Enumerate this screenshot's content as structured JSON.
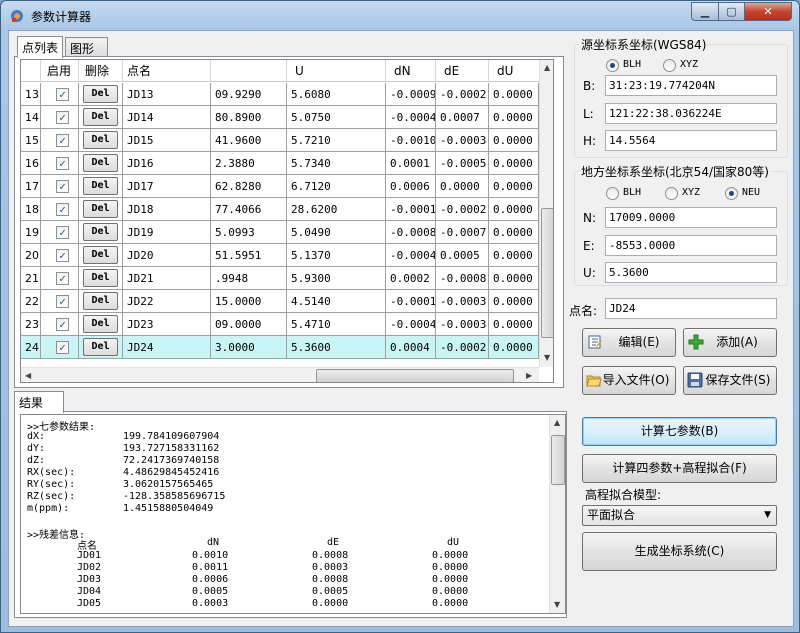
{
  "window": {
    "title": "参数计算器"
  },
  "tabs": {
    "points": "点列表",
    "graph": "图形",
    "results": "结果"
  },
  "grid": {
    "headers": {
      "enable": "启用",
      "delete": "删除",
      "name": "点名",
      "blank": "",
      "u": "U",
      "dn": "dN",
      "de": "dE",
      "du": "dU"
    },
    "del_label": "Del",
    "rows": [
      {
        "idx": "13",
        "name": "JD13",
        "h": "09.9290",
        "u": "5.6080",
        "dn": "-0.0009",
        "de": "-0.0002",
        "du": "0.0000"
      },
      {
        "idx": "14",
        "name": "JD14",
        "h": "80.8900",
        "u": "5.0750",
        "dn": "-0.0004",
        "de": "0.0007",
        "du": "0.0000"
      },
      {
        "idx": "15",
        "name": "JD15",
        "h": "41.9600",
        "u": "5.7210",
        "dn": "-0.0010",
        "de": "-0.0003",
        "du": "0.0000"
      },
      {
        "idx": "16",
        "name": "JD16",
        "h": "2.3880",
        "u": "5.7340",
        "dn": "0.0001",
        "de": "-0.0005",
        "du": "0.0000"
      },
      {
        "idx": "17",
        "name": "JD17",
        "h": "62.8280",
        "u": "6.7120",
        "dn": "0.0006",
        "de": "0.0000",
        "du": "0.0000"
      },
      {
        "idx": "18",
        "name": "JD18",
        "h": "77.4066",
        "u": "28.6200",
        "dn": "-0.0001",
        "de": "-0.0002",
        "du": "0.0000"
      },
      {
        "idx": "19",
        "name": "JD19",
        "h": "5.0993",
        "u": "5.0490",
        "dn": "-0.0008",
        "de": "-0.0007",
        "du": "0.0000"
      },
      {
        "idx": "20",
        "name": "JD20",
        "h": "51.5951",
        "u": "5.1370",
        "dn": "-0.0004",
        "de": "0.0005",
        "du": "0.0000"
      },
      {
        "idx": "21",
        "name": "JD21",
        "h": ".9948",
        "u": "5.9300",
        "dn": "0.0002",
        "de": "-0.0008",
        "du": "0.0000"
      },
      {
        "idx": "22",
        "name": "JD22",
        "h": "15.0000",
        "u": "4.5140",
        "dn": "-0.0001",
        "de": "-0.0003",
        "du": "0.0000"
      },
      {
        "idx": "23",
        "name": "JD23",
        "h": "09.0000",
        "u": "5.4710",
        "dn": "-0.0004",
        "de": "-0.0003",
        "du": "0.0000"
      },
      {
        "idx": "24",
        "name": "JD24",
        "h": "3.0000",
        "u": "5.3600",
        "dn": "0.0004",
        "de": "-0.0002",
        "du": "0.0000"
      }
    ]
  },
  "results": {
    "seven_title": ">>七参数结果:",
    "params": [
      {
        "k": "dX:",
        "v": "199.784109607904"
      },
      {
        "k": "dY:",
        "v": "193.727158331162"
      },
      {
        "k": "dZ:",
        "v": "72.2417369740158"
      },
      {
        "k": "RX(sec):",
        "v": "4.48629845452416"
      },
      {
        "k": "RY(sec):",
        "v": "3.0620157565465"
      },
      {
        "k": "RZ(sec):",
        "v": "-128.358585696715"
      },
      {
        "k": "m(ppm):",
        "v": "1.4515880504049"
      }
    ],
    "residual_title": ">>残差信息:",
    "res_headers": {
      "name": "点名",
      "dn": "dN",
      "de": "dE",
      "du": "dU"
    },
    "residuals": [
      {
        "name": "JD01",
        "dn": "0.0010",
        "de": "0.0008",
        "du": "0.0000"
      },
      {
        "name": "JD02",
        "dn": "0.0011",
        "de": "0.0003",
        "du": "0.0000"
      },
      {
        "name": "JD03",
        "dn": "0.0006",
        "de": "0.0008",
        "du": "0.0000"
      },
      {
        "name": "JD04",
        "dn": "0.0005",
        "de": "0.0005",
        "du": "0.0000"
      },
      {
        "name": "JD05",
        "dn": "0.0003",
        "de": "0.0000",
        "du": "0.0000"
      }
    ]
  },
  "source": {
    "title": "源坐标系坐标(WGS84)",
    "radio_blh": "BLH",
    "radio_xyz": "XYZ",
    "b_label": "B:",
    "b_value": "31:23:19.774204N",
    "l_label": "L:",
    "l_value": "121:22:38.036224E",
    "h_label": "H:",
    "h_value": "14.5564"
  },
  "local": {
    "title": "地方坐标系坐标(北京54/国家80等)",
    "radio_blh": "BLH",
    "radio_xyz": "XYZ",
    "radio_neu": "NEU",
    "n_label": "N:",
    "n_value": "17009.0000",
    "e_label": "E:",
    "e_value": "-8553.0000",
    "u_label": "U:",
    "u_value": "5.3600"
  },
  "point_name": {
    "label": "点名:",
    "value": "JD24"
  },
  "buttons": {
    "edit": "编辑(E)",
    "add": "添加(A)",
    "import": "导入文件(O)",
    "save": "保存文件(S)",
    "calc7": "计算七参数(B)",
    "calc4": "计算四参数+高程拟合(F)",
    "gen": "生成坐标系统(C)"
  },
  "elevation": {
    "label": "高程拟合模型:",
    "selected": "平面拟合"
  }
}
